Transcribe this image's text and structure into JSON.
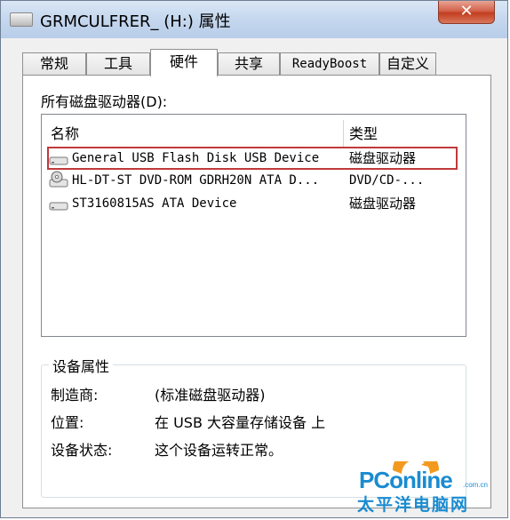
{
  "window": {
    "title": "GRMCULFRER_ (H:) 属性",
    "close_glyph": "✕"
  },
  "tabs": [
    {
      "label": "常规"
    },
    {
      "label": "工具"
    },
    {
      "label": "硬件"
    },
    {
      "label": "共享"
    },
    {
      "label": "ReadyBoost"
    },
    {
      "label": "自定义"
    }
  ],
  "active_tab": "硬件",
  "drives": {
    "label": "所有磁盘驱动器(D):",
    "columns": [
      "名称",
      "类型"
    ],
    "rows": [
      {
        "name": "General USB Flash Disk USB Device",
        "type": "磁盘驱动器",
        "icon": "usb-drive-icon",
        "highlighted": true
      },
      {
        "name": "HL-DT-ST DVD-ROM GDRH20N ATA D...",
        "type": "DVD/CD-...",
        "icon": "dvd-drive-icon",
        "highlighted": false
      },
      {
        "name": "ST3160815AS ATA Device",
        "type": "磁盘驱动器",
        "icon": "hard-disk-icon",
        "highlighted": false
      }
    ]
  },
  "device_properties": {
    "title": "设备属性",
    "items": [
      {
        "label": "制造商:",
        "value": "(标准磁盘驱动器)"
      },
      {
        "label": "位置:",
        "value": "在 USB 大容量存储设备 上"
      },
      {
        "label": "设备状态:",
        "value": "这个设备运转正常。"
      }
    ]
  },
  "watermark": {
    "brand": "PConline",
    "domain": ".com.cn",
    "cn_name": "太平洋电脑网"
  },
  "colors": {
    "highlight_border": "#c0393b",
    "watermark_blue": "#1a8bd0",
    "watermark_orange": "#f39a1e"
  }
}
